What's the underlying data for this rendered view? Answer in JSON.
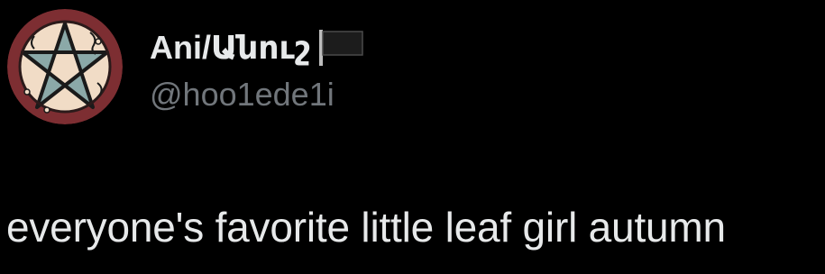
{
  "author": {
    "display_name": "Ani/Անուշ",
    "handle": "@hoo1ede1i",
    "avatar_icon": "pentagram-avatar-icon",
    "flag_icon": "black-flag-icon"
  },
  "post": {
    "text": "everyone's favorite little leaf girl autumn"
  },
  "colors": {
    "background": "#000000",
    "primary_text": "#e7e9ea",
    "secondary_text": "#71767b",
    "avatar_ring": "#7d2e32"
  }
}
